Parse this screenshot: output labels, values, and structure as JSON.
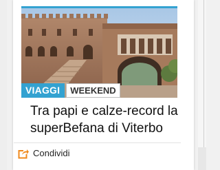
{
  "article": {
    "tags": {
      "primary": "VIAGGI",
      "secondary": "WEEKEND"
    },
    "title": "Tra papi e calze-record la superBefana di Viterbo",
    "share_label": "Condividi"
  },
  "colors": {
    "accent": "#33a2d1",
    "share_icon": "#f08a1c"
  },
  "icons": {
    "share": "share-arrow-icon"
  }
}
